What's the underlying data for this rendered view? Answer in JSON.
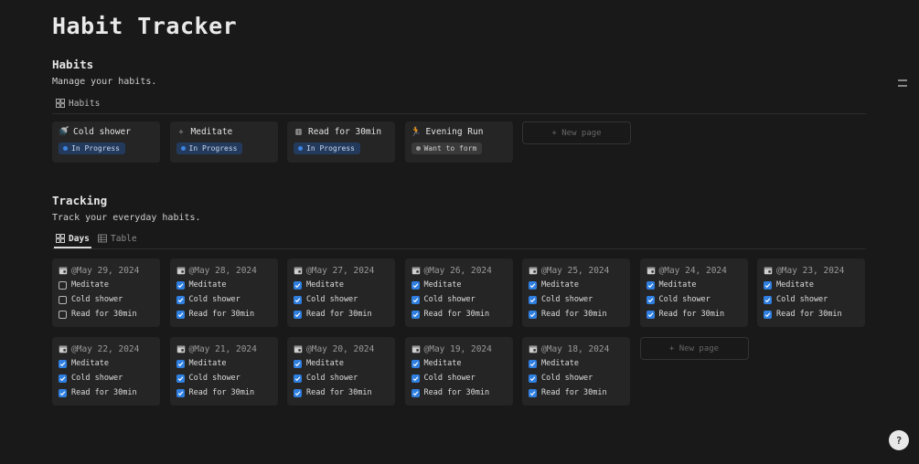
{
  "title": "Habit Tracker",
  "habits": {
    "heading": "Habits",
    "description": "Manage your habits.",
    "view_tab": "Habits",
    "cards": [
      {
        "icon": "shower-icon",
        "glyph": "🚿",
        "name": "Cold shower",
        "status": "In Progress",
        "status_kind": "progress"
      },
      {
        "icon": "sparkle-icon",
        "glyph": "✧",
        "name": "Meditate",
        "status": "In Progress",
        "status_kind": "progress"
      },
      {
        "icon": "book-icon",
        "glyph": "▥",
        "name": "Read for 30min",
        "status": "In Progress",
        "status_kind": "progress"
      },
      {
        "icon": "runner-icon",
        "glyph": "🏃",
        "name": "Evening Run",
        "status": "Want to form",
        "status_kind": "form"
      }
    ],
    "new_page": "+ New page"
  },
  "tracking": {
    "heading": "Tracking",
    "description": "Track your everyday habits.",
    "tabs": [
      {
        "label": "Days",
        "active": true
      },
      {
        "label": "Table",
        "active": false
      }
    ],
    "days": [
      {
        "date": "@May 29, 2024",
        "checks": [
          {
            "label": "Meditate",
            "checked": false
          },
          {
            "label": "Cold shower",
            "checked": false
          },
          {
            "label": "Read for 30min",
            "checked": false
          }
        ]
      },
      {
        "date": "@May 28, 2024",
        "checks": [
          {
            "label": "Meditate",
            "checked": true
          },
          {
            "label": "Cold shower",
            "checked": true
          },
          {
            "label": "Read for 30min",
            "checked": true
          }
        ]
      },
      {
        "date": "@May 27, 2024",
        "checks": [
          {
            "label": "Meditate",
            "checked": true
          },
          {
            "label": "Cold shower",
            "checked": true
          },
          {
            "label": "Read for 30min",
            "checked": true
          }
        ]
      },
      {
        "date": "@May 26, 2024",
        "checks": [
          {
            "label": "Meditate",
            "checked": true
          },
          {
            "label": "Cold shower",
            "checked": true
          },
          {
            "label": "Read for 30min",
            "checked": true
          }
        ]
      },
      {
        "date": "@May 25, 2024",
        "checks": [
          {
            "label": "Meditate",
            "checked": true
          },
          {
            "label": "Cold shower",
            "checked": true
          },
          {
            "label": "Read for 30min",
            "checked": true
          }
        ]
      },
      {
        "date": "@May 24, 2024",
        "checks": [
          {
            "label": "Meditate",
            "checked": true
          },
          {
            "label": "Cold shower",
            "checked": true
          },
          {
            "label": "Read for 30min",
            "checked": true
          }
        ]
      },
      {
        "date": "@May 23, 2024",
        "checks": [
          {
            "label": "Meditate",
            "checked": true
          },
          {
            "label": "Cold shower",
            "checked": true
          },
          {
            "label": "Read for 30min",
            "checked": true
          }
        ]
      },
      {
        "date": "@May 22, 2024",
        "checks": [
          {
            "label": "Meditate",
            "checked": true
          },
          {
            "label": "Cold shower",
            "checked": true
          },
          {
            "label": "Read for 30min",
            "checked": true
          }
        ]
      },
      {
        "date": "@May 21, 2024",
        "checks": [
          {
            "label": "Meditate",
            "checked": true
          },
          {
            "label": "Cold shower",
            "checked": true
          },
          {
            "label": "Read for 30min",
            "checked": true
          }
        ]
      },
      {
        "date": "@May 20, 2024",
        "checks": [
          {
            "label": "Meditate",
            "checked": true
          },
          {
            "label": "Cold shower",
            "checked": true
          },
          {
            "label": "Read for 30min",
            "checked": true
          }
        ]
      },
      {
        "date": "@May 19, 2024",
        "checks": [
          {
            "label": "Meditate",
            "checked": true
          },
          {
            "label": "Cold shower",
            "checked": true
          },
          {
            "label": "Read for 30min",
            "checked": true
          }
        ]
      },
      {
        "date": "@May 18, 2024",
        "checks": [
          {
            "label": "Meditate",
            "checked": true
          },
          {
            "label": "Cold shower",
            "checked": true
          },
          {
            "label": "Read for 30min",
            "checked": true
          }
        ]
      }
    ],
    "new_page": "+ New page"
  },
  "colors": {
    "background": "#191919",
    "card": "#252525",
    "checkbox_accent": "#2f7fe0",
    "progress_badge": "#243a5c"
  }
}
